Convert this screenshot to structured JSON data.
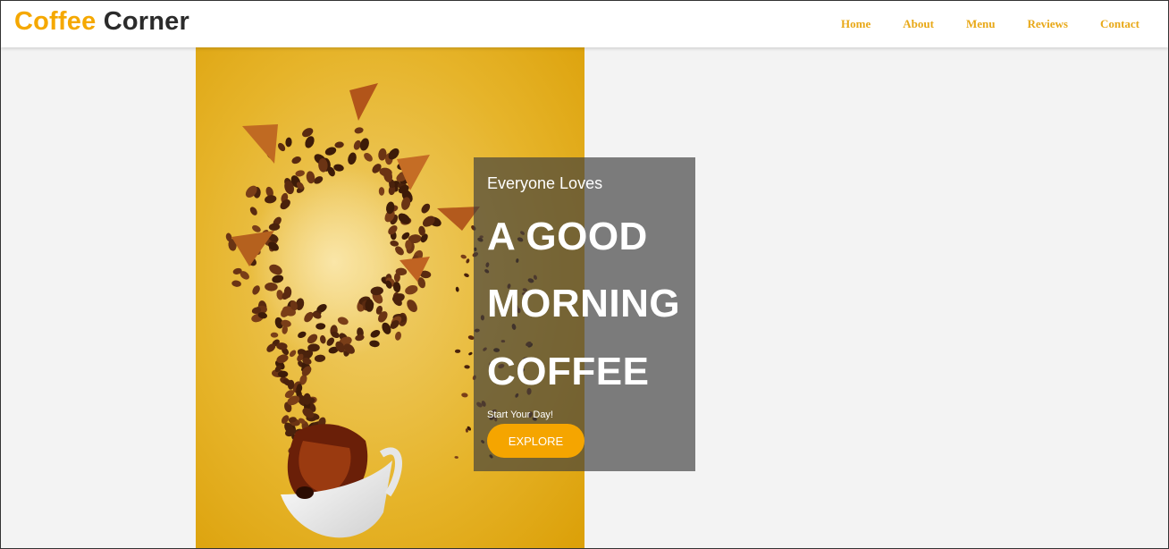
{
  "brand": {
    "part1": "Coffee",
    "part2": "Corner"
  },
  "nav": {
    "items": [
      "Home",
      "About",
      "Menu",
      "Reviews",
      "Contact"
    ]
  },
  "hero": {
    "small_title": "Everyone Loves",
    "headline": [
      "A GOOD",
      "MORNING",
      "COFFEE"
    ],
    "subtitle": "Start Your Day!",
    "cta": "EXPLORE"
  },
  "colors": {
    "accent": "#f5a800",
    "nav_link": "#e8a817",
    "hero_bg": "#e6b42a",
    "overlay": "rgba(60,60,60,0.66)"
  }
}
